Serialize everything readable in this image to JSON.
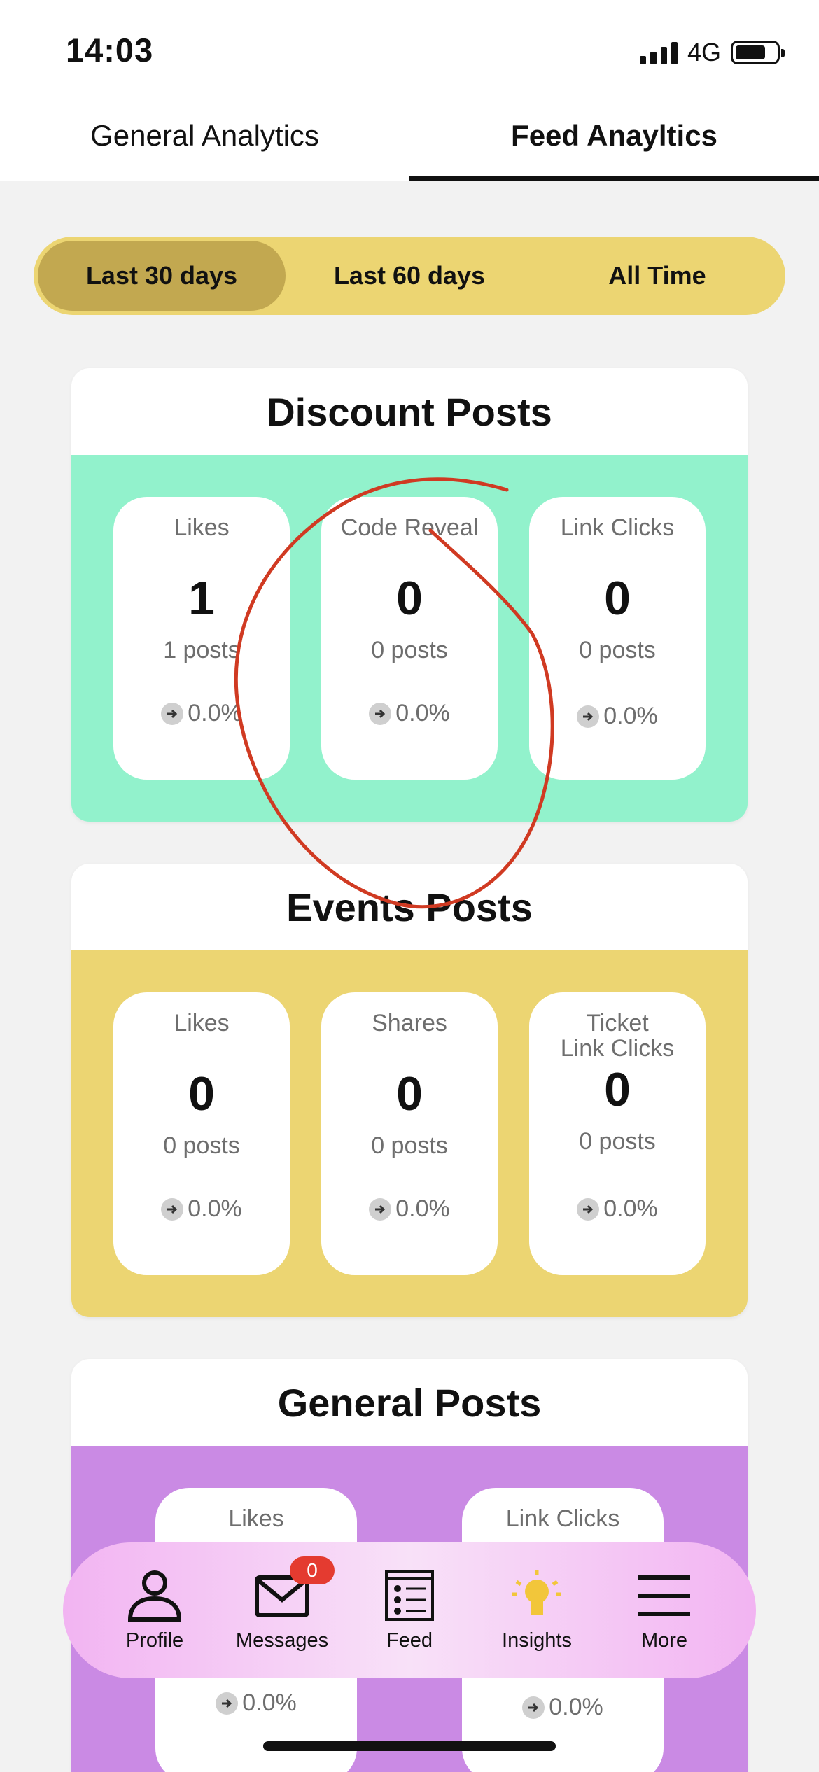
{
  "status": {
    "time": "14:03",
    "network": "4G"
  },
  "tabs": [
    {
      "label": "General Analytics"
    },
    {
      "label": "Feed Anayltics"
    }
  ],
  "range": {
    "options": [
      "Last 30 days",
      "Last 60 days",
      "All Time"
    ],
    "selected": "Last 30 days"
  },
  "sections": {
    "discount": {
      "title": "Discount Posts",
      "color": "#92f2cc",
      "stats": [
        {
          "label": "Likes",
          "value": "1",
          "posts": "1 posts",
          "pct": "0.0%"
        },
        {
          "label": "Code Reveal",
          "value": "0",
          "posts": "0 posts",
          "pct": "0.0%"
        },
        {
          "label": "Link Clicks",
          "value": "0",
          "posts": "0 posts",
          "pct": "0.0%"
        }
      ]
    },
    "events": {
      "title": "Events Posts",
      "color": "#ecd572",
      "stats": [
        {
          "label": "Likes",
          "value": "0",
          "posts": "0 posts",
          "pct": "0.0%"
        },
        {
          "label": "Shares",
          "value": "0",
          "posts": "0 posts",
          "pct": "0.0%"
        },
        {
          "label_line1": "Ticket",
          "label_line2": "Link Clicks",
          "value": "0",
          "posts": "0 posts",
          "pct": "0.0%"
        }
      ]
    },
    "general": {
      "title": "General Posts",
      "color": "#ca8ae4",
      "stats": [
        {
          "label": "Likes",
          "pct": "0.0%"
        },
        {
          "label": "Link Clicks",
          "pct": "0.0%"
        }
      ]
    }
  },
  "nav": {
    "items": [
      {
        "label": "Profile",
        "icon": "person-icon"
      },
      {
        "label": "Messages",
        "icon": "envelope-icon",
        "badge": "0"
      },
      {
        "label": "Feed",
        "icon": "feed-icon"
      },
      {
        "label": "Insights",
        "icon": "lightbulb-icon"
      },
      {
        "label": "More",
        "icon": "menu-icon"
      }
    ]
  },
  "annotation_color": "#d03a22"
}
